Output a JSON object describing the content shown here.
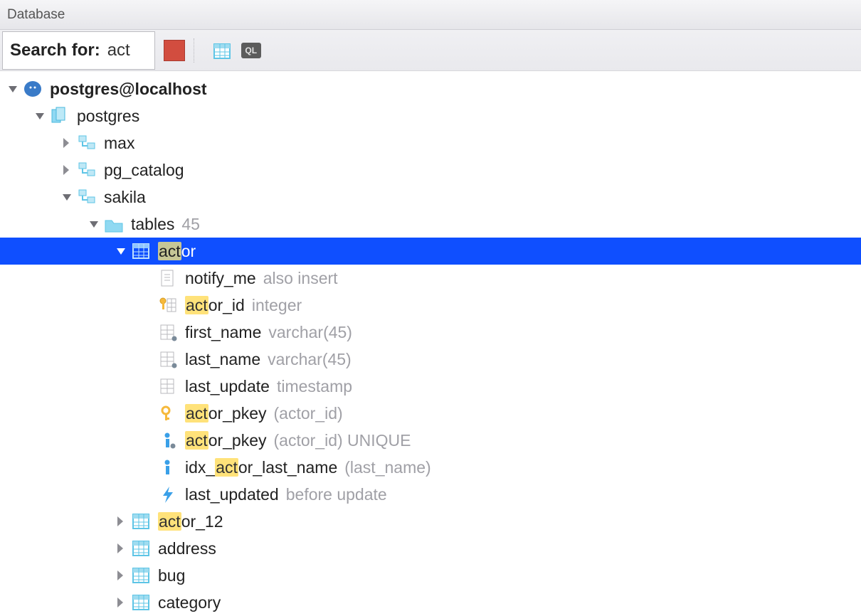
{
  "window_title": "Database",
  "search": {
    "label": "Search for:",
    "value": "act"
  },
  "datasource": {
    "name": "postgres@localhost",
    "icon": "elephant"
  },
  "database": "postgres",
  "schemas": [
    {
      "name": "max",
      "expanded": false
    },
    {
      "name": "pg_catalog",
      "expanded": false
    },
    {
      "name": "sakila",
      "expanded": true
    }
  ],
  "tables_group": {
    "label": "tables",
    "count": "45"
  },
  "selected_table": "actor",
  "actor_children": [
    {
      "kind": "trigger-file",
      "name": "notify_me",
      "detail": "also insert"
    },
    {
      "kind": "pk-col",
      "name": "actor_id",
      "detail": "integer"
    },
    {
      "kind": "col",
      "name": "first_name",
      "detail": "varchar(45)"
    },
    {
      "kind": "col",
      "name": "last_name",
      "detail": "varchar(45)"
    },
    {
      "kind": "col-plain",
      "name": "last_update",
      "detail": "timestamp"
    },
    {
      "kind": "key",
      "name": "actor_pkey",
      "detail": "(actor_id)"
    },
    {
      "kind": "index",
      "name": "actor_pkey",
      "detail": "(actor_id) UNIQUE"
    },
    {
      "kind": "index-plain",
      "name": "idx_actor_last_name",
      "detail": "(last_name)"
    },
    {
      "kind": "trigger",
      "name": "last_updated",
      "detail": "before update"
    }
  ],
  "sibling_tables": [
    "actor_12",
    "address",
    "bug",
    "category"
  ],
  "highlight": "act"
}
